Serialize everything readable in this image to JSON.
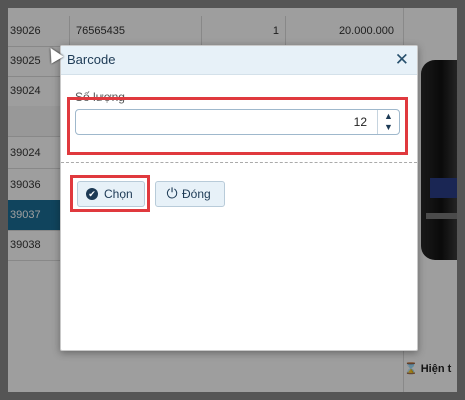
{
  "table": {
    "rows": [
      {
        "code": "39026",
        "barcode": "76565435",
        "qty": "1",
        "amount": "20.000.000",
        "selected": false
      },
      {
        "code": "39025",
        "barcode": "",
        "qty": "",
        "amount": "",
        "selected": false
      },
      {
        "code": "39024",
        "barcode": "",
        "qty": "",
        "amount": "",
        "selected": false
      },
      {
        "code": "",
        "barcode": "",
        "qty": "",
        "amount": "",
        "selected": false
      },
      {
        "code": "39024",
        "barcode": "",
        "qty": "",
        "amount": "",
        "selected": false
      },
      {
        "code": "39036",
        "barcode": "",
        "qty": "",
        "amount": "",
        "selected": false
      },
      {
        "code": "39037",
        "barcode": "",
        "qty": "",
        "amount": "",
        "selected": true
      },
      {
        "code": "39038",
        "barcode": "",
        "qty": "",
        "amount": "",
        "selected": false
      }
    ]
  },
  "right_panel": {
    "bottom_label": "Hiện t"
  },
  "dialog": {
    "title": "Barcode",
    "close_glyph": "✕",
    "field_label": "Số lượng",
    "quantity_value": "12",
    "buttons": {
      "choose_label": "Chọn",
      "close_label": "Đóng"
    }
  },
  "colors": {
    "accent": "#1b6e96",
    "highlight_box": "#e0393e",
    "dialog_header": "#e7f1f8"
  },
  "icons": {
    "close": "close-icon",
    "spinner": "up-down-spinner-icon",
    "choose": "check-circle-icon",
    "close_btn": "power-icon",
    "bottom": "hourglass-icon"
  }
}
